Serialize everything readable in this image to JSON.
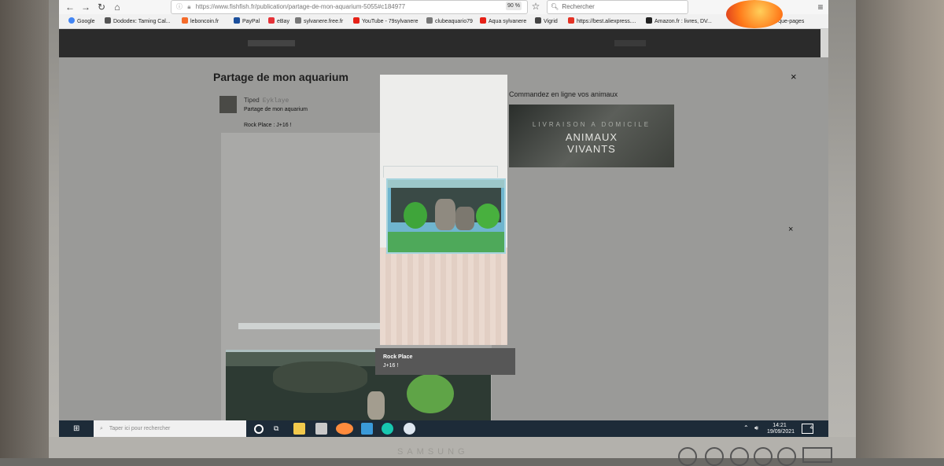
{
  "browser": {
    "url": "https://www.fishfish.fr/publication/partage-de-mon-aquarium-5055#c184977",
    "zoom": "90 %",
    "search_placeholder": "Rechercher",
    "other_bookmarks": "Autres marque-pages",
    "bookmarks": [
      {
        "label": "Google",
        "color": "#4285f4"
      },
      {
        "label": "Dododex: Taming Cal...",
        "color": "#555555"
      },
      {
        "label": "leboncoin.fr",
        "color": "#f56b2a"
      },
      {
        "label": "PayPal",
        "color": "#1b4f9c"
      },
      {
        "label": "eBay",
        "color": "#e53238"
      },
      {
        "label": "sylvanere.free.fr",
        "color": "#777777"
      },
      {
        "label": "YouTube - 79sylvanere",
        "color": "#e62117"
      },
      {
        "label": "clubeaquario79",
        "color": "#777777"
      },
      {
        "label": "Aqua sylvanere",
        "color": "#e62117"
      },
      {
        "label": "Vigrid",
        "color": "#444444"
      },
      {
        "label": "https://best.aliexpress....",
        "color": "#e43225"
      },
      {
        "label": "Amazon.fr : livres, DV...",
        "color": "#222222"
      }
    ]
  },
  "modal": {
    "title": "Partage de mon aquarium",
    "close_glyph": "×"
  },
  "post": {
    "user": "Tiped",
    "handle": "Eyklaye",
    "title": "Partage de mon aquarium",
    "caption": "Rock Place : J+16 !"
  },
  "ad": {
    "title": "Commandez en ligne vos animaux",
    "line1": "LIVRAISON A DOMICILE",
    "line2a": "ANIMAUX",
    "line2b": "VIVANTS"
  },
  "lightbox": {
    "caption_title": "Rock Place",
    "caption_sub": "J+16 !"
  },
  "taskbar": {
    "search_placeholder": "Taper ici pour rechercher",
    "time": "14:21",
    "date": "19/09/2021",
    "notification_count": "4"
  },
  "colors": {
    "taskbar": "#1d2b38",
    "site_nav": "#2b2b2b",
    "page_dim": "#9a9a98"
  }
}
